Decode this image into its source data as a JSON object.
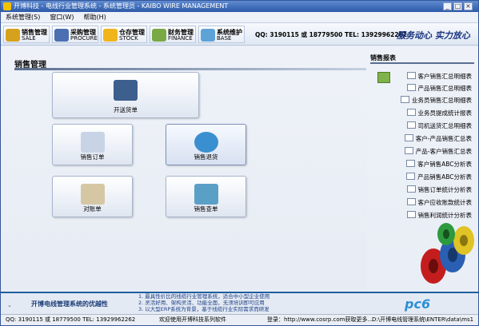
{
  "window": {
    "title": "开博科技 - 电线行业管理系统 - 系统管理员 - KAIBO WIRE MANAGEMENT"
  },
  "menu": [
    "系统管理(S)",
    "窗口(W)",
    "帮助(H)"
  ],
  "toolbar": {
    "items": [
      {
        "cn": "销售管理",
        "en": "SALE",
        "icon": "scales-icon",
        "color": "#d6a11c"
      },
      {
        "cn": "采购管理",
        "en": "PROCURE",
        "icon": "cash-register-icon",
        "color": "#4c6fb2"
      },
      {
        "cn": "仓存管理",
        "en": "STOCK",
        "icon": "warehouse-icon",
        "color": "#f0b51d"
      },
      {
        "cn": "财务管理",
        "en": "FINANCE",
        "icon": "calculator-icon",
        "color": "#78a944"
      },
      {
        "cn": "系统维护",
        "en": "BASE",
        "icon": "computer-icon",
        "color": "#5ea3d8"
      }
    ],
    "phones": "QQ: 3190115 或 18779500  TEL: 13929962262",
    "slogan": "服务动心 实力放心"
  },
  "main": {
    "title": "销售管理",
    "tiles": [
      {
        "label": "开送货单",
        "icon": "truck-icon",
        "color": "#3d5f8e"
      },
      {
        "label": "销售订单",
        "icon": "document-icon",
        "color": "#c8d4e6"
      },
      {
        "label": "销售退货",
        "icon": "globe-icon",
        "color": "#3a8fd0"
      },
      {
        "label": "对账单",
        "icon": "check-paper-icon",
        "color": "#d6c7a4"
      },
      {
        "label": "销售查单",
        "icon": "magnifier-icon",
        "color": "#5aa0c6"
      }
    ]
  },
  "reports": {
    "title": "销售报表",
    "items": [
      "客户销售汇总明细表",
      "产品销售汇总明细表",
      "业务员销售汇总明细表",
      "业务员提成统计报表",
      "司机送货汇总明细表",
      "客户-产品销售汇总表",
      "产品-客户销售汇总表",
      "客户销售ABC分析表",
      "产品销售ABC分析表",
      "销售订单统计分析表",
      "客户应收账款统计表",
      "销售利润统计分析表"
    ]
  },
  "banner": {
    "title": "开博电线管理系统的优越性",
    "points": [
      "1. 最具性价比的线缆行业管理系统，适合中小型企业使用",
      "2. 灵活好用、架构灵活、功能全面，无须培训即可应用",
      "3. 以大型ERP系统为背景，基于线缆行业实际需求而研发"
    ],
    "logo": "pc6"
  },
  "status": {
    "contact": "QQ: 3190115 或 18779500  TEL: 13929962262",
    "welcome": "欢迎使用开博科技系列软件",
    "login": "登录：http://www.cosrp.com获取更多...",
    "path": "D:\\开博电线管理系统\\ENTER\\data\\ms1"
  }
}
